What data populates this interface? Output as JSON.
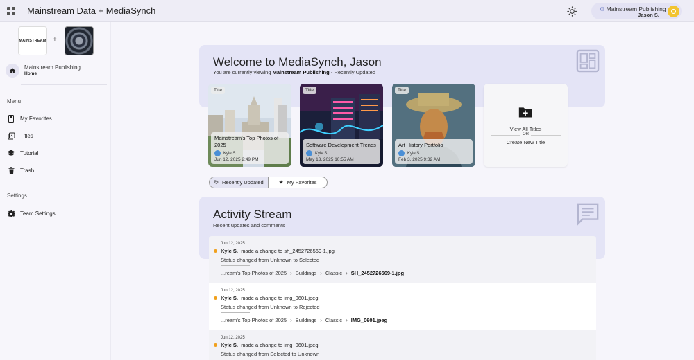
{
  "header": {
    "title": "Mainstream Data + MediaSynch",
    "account_org": "Mainstream Publishing",
    "account_user": "Jason S."
  },
  "sidebar": {
    "logo_text": "MAINSTREAM",
    "plus": "+",
    "home": {
      "org": "Mainstream Publishing",
      "label": "Home"
    },
    "menu_heading": "Menu",
    "items": [
      {
        "label": "My Favorites",
        "icon": "bookmark-icon"
      },
      {
        "label": "Titles",
        "icon": "titles-icon"
      },
      {
        "label": "Tutorial",
        "icon": "graduation-cap-icon"
      },
      {
        "label": "Trash",
        "icon": "trash-icon"
      }
    ],
    "settings_heading": "Settings",
    "settings_items": [
      {
        "label": "Team Settings",
        "icon": "gear-icon"
      }
    ]
  },
  "welcome": {
    "title": "Welcome to MediaSynch, Jason",
    "sub_prefix": "You are currently viewing",
    "sub_org": "Mainstream Publishing",
    "sub_suffix": "- Recently Updated"
  },
  "tiles": [
    {
      "tag": "Title",
      "name": "Mainstream's Top Photos of 2025",
      "user": "Kyle S.",
      "date": "Jun 12, 2025 2:49 PM"
    },
    {
      "tag": "Title",
      "name": "Software Development Trends",
      "user": "Kyle S.",
      "date": "May 13, 2025 10:55 AM"
    },
    {
      "tag": "Title",
      "name": "Art History Portfolio",
      "user": "Kyle S.",
      "date": "Feb 3, 2025 9:32 AM"
    }
  ],
  "view_all": {
    "view_label": "View All Titles",
    "or_label": "OR",
    "create_label": "Create New Title"
  },
  "toggle": {
    "recent": "Recently Updated",
    "favorites": "My Favorites"
  },
  "activity": {
    "title": "Activity Stream",
    "sub": "Recent updates and comments",
    "items": [
      {
        "date": "Jun 12, 2025",
        "user": "Kyle S.",
        "action": "made a change to sh_2452726569-1.jpg",
        "status": "Status changed from Unknown to Selected",
        "path": [
          "...ream's Top Photos of 2025",
          "Buildings",
          "Classic",
          "SH_2452726569-1.jpg"
        ]
      },
      {
        "date": "Jun 12, 2025",
        "user": "Kyle S.",
        "action": "made a change to img_0601.jpeg",
        "status": "Status changed from Unknown to Rejected",
        "path": [
          "...ream's Top Photos of 2025",
          "Buildings",
          "Classic",
          "IMG_0601.jpeg"
        ]
      },
      {
        "date": "Jun 12, 2025",
        "user": "Kyle S.",
        "action": "made a change to img_0601.jpeg",
        "status": "Status changed from Selected to Unknown",
        "path": []
      }
    ]
  },
  "colors": {
    "accent_panel": "#e4e4f6",
    "activity_dot": "#f0a01c",
    "avatar": "#f2c42f"
  }
}
